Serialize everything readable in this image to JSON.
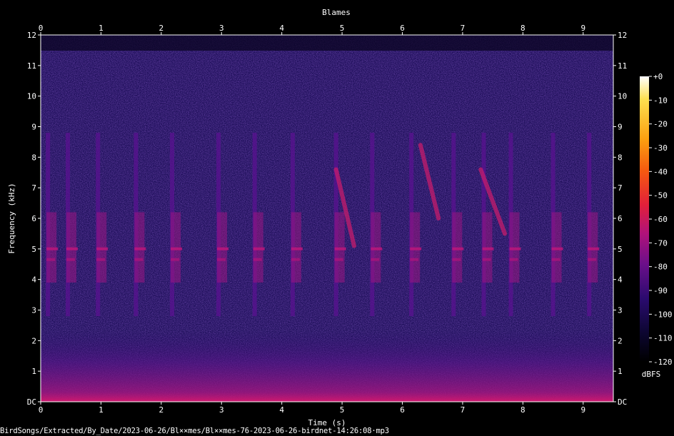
{
  "chart_data": {
    "type": "heatmap",
    "title": "Blames",
    "xlabel": "Time (s)",
    "ylabel": "Frequency (kHz)",
    "xlim": [
      0,
      9.5
    ],
    "ylim": [
      0,
      12
    ],
    "x_ticks": [
      "0",
      "1",
      "2",
      "3",
      "4",
      "5",
      "6",
      "7",
      "8",
      "9"
    ],
    "y_ticks": [
      "DC",
      "1",
      "2",
      "3",
      "4",
      "5",
      "6",
      "7",
      "8",
      "9",
      "10",
      "11",
      "12"
    ],
    "colorbar": {
      "unit": "dBFS",
      "range": [
        -120,
        0
      ],
      "ticks": [
        "+0",
        "-10",
        "-20",
        "-30",
        "-40",
        "-50",
        "-60",
        "-70",
        "-80",
        "-90",
        "-100",
        "-110",
        "-120"
      ],
      "colors": [
        "#000000",
        "#0c0630",
        "#2a0b6e",
        "#6a0f8a",
        "#b0127a",
        "#e2203a",
        "#f55a10",
        "#fca010",
        "#fde050",
        "#ffffff"
      ]
    },
    "background_color": "#1e0f5a",
    "calls_time_s": [
      0.12,
      0.45,
      0.95,
      1.58,
      2.18,
      2.95,
      3.55,
      4.18,
      4.9,
      5.5,
      6.15,
      6.85,
      7.35,
      7.8,
      8.5,
      9.1
    ]
  },
  "footer": "BirdSongs/Extracted/By_Date/2023-06-26/Bl××mes/Bl××mes-76-2023-06-26-birdnet-14:26:08·mp3"
}
